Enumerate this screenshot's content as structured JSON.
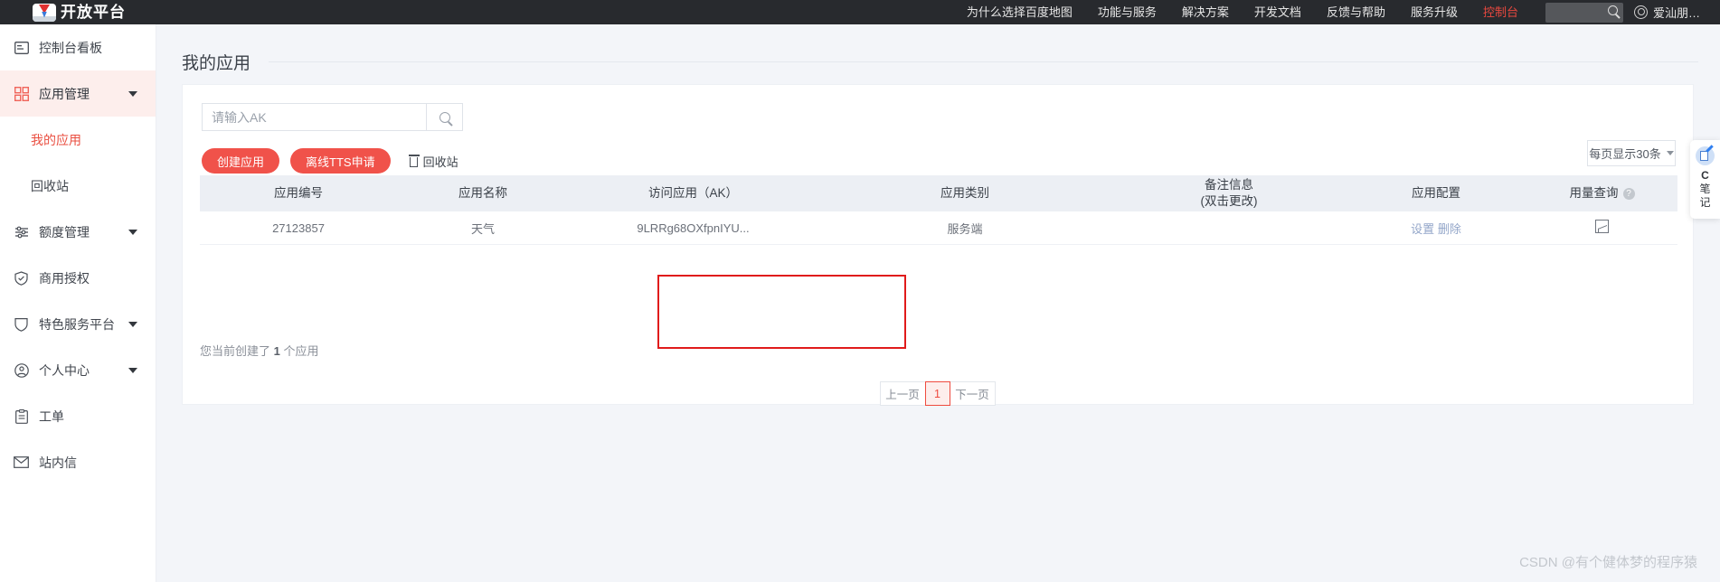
{
  "topbar": {
    "logo_text": "开放平台",
    "nav_items": [
      {
        "label": "为什么选择百度地图",
        "accent": false
      },
      {
        "label": "功能与服务",
        "accent": false
      },
      {
        "label": "解决方案",
        "accent": false
      },
      {
        "label": "开发文档",
        "accent": false
      },
      {
        "label": "反馈与帮助",
        "accent": false
      },
      {
        "label": "服务升级",
        "accent": false
      },
      {
        "label": "控制台",
        "accent": true
      }
    ],
    "search_placeholder": "",
    "user_name": "爱汕朋…"
  },
  "sidebar": {
    "items": [
      {
        "label": "控制台看板",
        "icon": "dashboard-icon",
        "active": false,
        "caret": false
      },
      {
        "label": "应用管理",
        "icon": "apps-grid-icon",
        "active": true,
        "caret": true
      },
      {
        "label": "额度管理",
        "icon": "sliders-icon",
        "active": false,
        "caret": true
      },
      {
        "label": "商用授权",
        "icon": "shield-check-icon",
        "active": false,
        "caret": false
      },
      {
        "label": "特色服务平台",
        "icon": "shield-icon",
        "active": false,
        "caret": true
      },
      {
        "label": "个人中心",
        "icon": "user-circle-icon",
        "active": false,
        "caret": true
      },
      {
        "label": "工单",
        "icon": "clipboard-icon",
        "active": false,
        "caret": false
      },
      {
        "label": "站内信",
        "icon": "mail-icon",
        "active": false,
        "caret": false
      }
    ],
    "sub_items": [
      {
        "label": "我的应用",
        "selected": true
      },
      {
        "label": "回收站",
        "selected": false
      }
    ]
  },
  "page": {
    "title": "我的应用"
  },
  "search": {
    "placeholder": "请输入AK",
    "value": "",
    "button_icon": "search-icon"
  },
  "toolbar": {
    "create_label": "创建应用",
    "tts_label": "离线TTS申请",
    "recycle_label": "回收站",
    "page_size_label": "每页显示30条"
  },
  "table": {
    "columns": [
      {
        "label": "应用编号",
        "sub": ""
      },
      {
        "label": "应用名称",
        "sub": ""
      },
      {
        "label": "访问应用（AK）",
        "sub": ""
      },
      {
        "label": "应用类别",
        "sub": ""
      },
      {
        "label": "备注信息",
        "sub": "(双击更改)"
      },
      {
        "label": "应用配置",
        "sub": ""
      },
      {
        "label": "用量查询",
        "sub": "",
        "help": "?"
      }
    ],
    "rows": [
      {
        "id": "27123857",
        "name": "天气",
        "ak": "9LRRg68OXfpnIYU...",
        "type": "服务端",
        "note": "",
        "config_links": [
          "设置",
          "删除"
        ],
        "usage_icon": "chart-icon"
      }
    ],
    "highlight_color": "#e01b1b"
  },
  "summary": {
    "prefix": "您当前创建了 ",
    "count": "1",
    "suffix": " 个应用"
  },
  "pagination": {
    "prev_label": "上一页",
    "current_page": "1",
    "next_label": "下一页"
  },
  "notes_widget": {
    "icon": "notepad-pen-icon",
    "letter": "C",
    "line1": "笔",
    "line2": "记"
  },
  "watermark": {
    "text": "CSDN @有个健体梦的程序猿"
  },
  "colors": {
    "accent_red": "#f0524a",
    "topbar_bg": "#282a2e",
    "active_bg": "#fdeeec",
    "table_head_bg": "#eceff4"
  }
}
